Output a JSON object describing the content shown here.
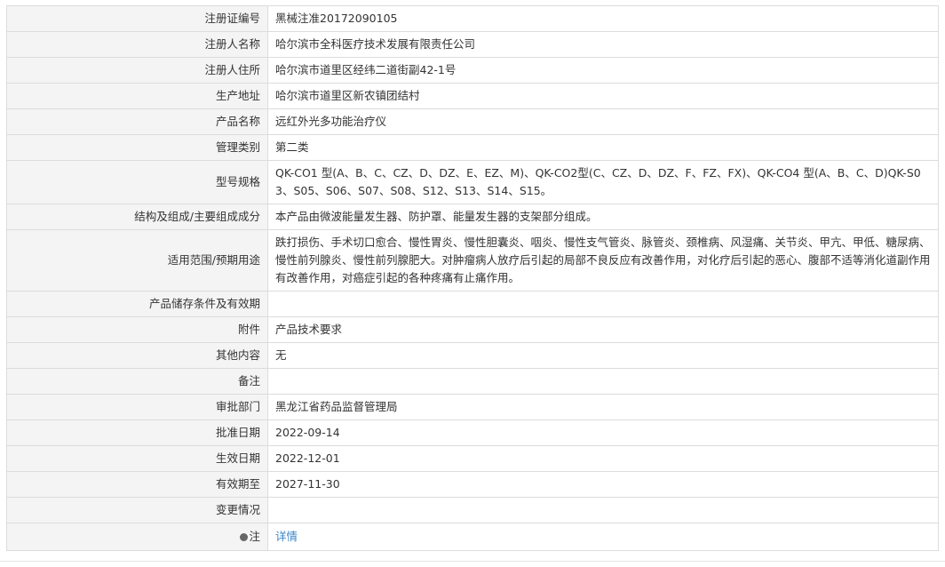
{
  "rows": [
    {
      "label": "注册证编号",
      "value": "黑械注准20172090105"
    },
    {
      "label": "注册人名称",
      "value": "哈尔滨市全科医疗技术发展有限责任公司"
    },
    {
      "label": "注册人住所",
      "value": "哈尔滨市道里区经纬二道街副42-1号"
    },
    {
      "label": "生产地址",
      "value": "哈尔滨市道里区新农镇团结村"
    },
    {
      "label": "产品名称",
      "value": "远红外光多功能治疗仪"
    },
    {
      "label": "管理类别",
      "value": "第二类"
    },
    {
      "label": "型号规格",
      "value": "QK-CO1 型(A、B、C、CZ、D、DZ、E、EZ、M)、QK-CO2型(C、CZ、D、DZ、F、FZ、FX)、QK-CO4 型(A、B、C、D)QK-S03、S05、S06、S07、S08、S12、S13、S14、S15。"
    },
    {
      "label": "结构及组成/主要组成成分",
      "value": "本产品由微波能量发生器、防护罩、能量发生器的支架部分组成。"
    },
    {
      "label": "适用范围/预期用途",
      "value": "跌打损伤、手术切口愈合、慢性胃炎、慢性胆囊炎、咽炎、慢性支气管炎、脉管炎、颈椎病、风湿痛、关节炎、甲亢、甲低、糖尿病、慢性前列腺炎、慢性前列腺肥大。对肿瘤病人放疗后引起的局部不良反应有改善作用，对化疗后引起的恶心、腹部不适等消化道副作用有改善作用，对癌症引起的各种疼痛有止痛作用。"
    },
    {
      "label": "产品储存条件及有效期",
      "value": ""
    },
    {
      "label": "附件",
      "value": "产品技术要求"
    },
    {
      "label": "其他内容",
      "value": "无"
    },
    {
      "label": "备注",
      "value": ""
    },
    {
      "label": "审批部门",
      "value": "黑龙江省药品监督管理局"
    },
    {
      "label": "批准日期",
      "value": "2022-09-14"
    },
    {
      "label": "生效日期",
      "value": "2022-12-01"
    },
    {
      "label": "有效期至",
      "value": "2027-11-30"
    },
    {
      "label": "变更情况",
      "value": ""
    }
  ],
  "note": {
    "label": "注",
    "icon": "info-icon",
    "link_text": "详情",
    "link_color": "#3a86c8"
  },
  "colors": {
    "label_bg": "#f4f4f4",
    "border": "#dcdcdc",
    "text": "#333333"
  }
}
